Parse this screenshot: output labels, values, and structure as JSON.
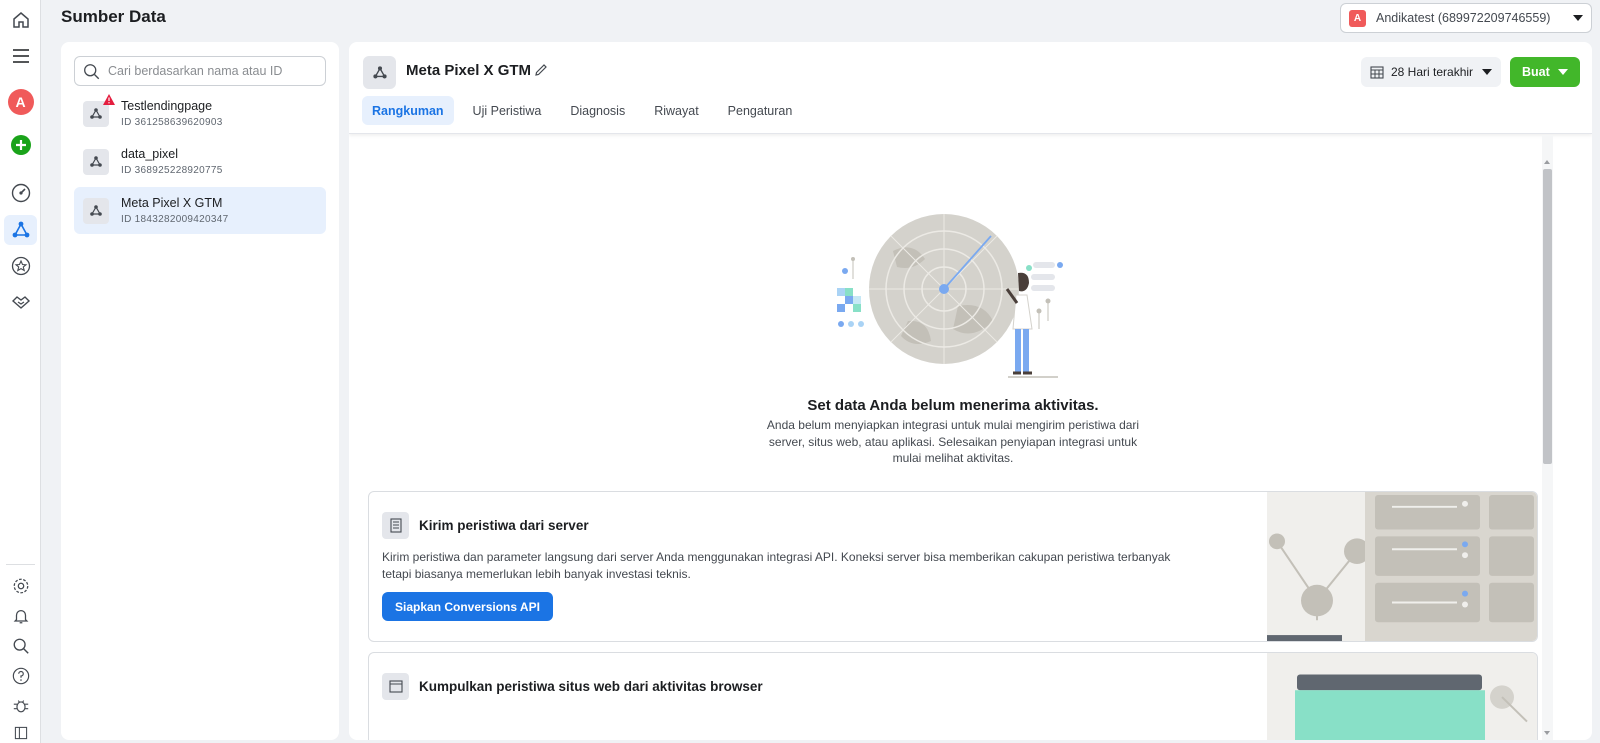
{
  "page": {
    "title": "Sumber Data"
  },
  "account": {
    "badge": "A",
    "name": "Andikatest (689972209746559)"
  },
  "rail": {
    "avatar_letter": "A",
    "top_icons": [
      "home-icon",
      "menu-icon",
      "avatar",
      "create-icon",
      "dashboard-icon",
      "data-sources-icon",
      "star-icon",
      "handshake-icon"
    ],
    "bottom_icons": [
      "settings-icon",
      "notifications-icon",
      "search-icon",
      "help-icon",
      "bug-icon",
      "sidebar-toggle-icon"
    ]
  },
  "sources": {
    "search_placeholder": "Cari berdasarkan nama atau ID",
    "items": [
      {
        "name": "Testlendingpage",
        "id": "ID 361258639620903",
        "warning": true
      },
      {
        "name": "data_pixel",
        "id": "ID 368925228920775",
        "warning": false
      },
      {
        "name": "Meta Pixel X GTM",
        "id": "ID 1843282009420347",
        "warning": false,
        "selected": true
      }
    ]
  },
  "main": {
    "title": "Meta Pixel X GTM",
    "tabs": [
      "Rangkuman",
      "Uji Peristiwa",
      "Diagnosis",
      "Riwayat",
      "Pengaturan"
    ],
    "active_tab": "Rangkuman",
    "date_range": "28 Hari terakhir",
    "create_label": "Buat",
    "empty": {
      "title": "Set data Anda belum menerima aktivitas.",
      "description": "Anda belum menyiapkan integrasi untuk mulai mengirim peristiwa dari server, situs web, atau aplikasi. Selesaikan penyiapan integrasi untuk mulai melihat aktivitas."
    },
    "cards": [
      {
        "title": "Kirim peristiwa dari server",
        "description": "Kirim peristiwa dan parameter langsung dari server Anda menggunakan integrasi API. Koneksi server bisa memberikan cakupan peristiwa terbanyak tetapi biasanya memerlukan lebih banyak investasi teknis.",
        "button": "Siapkan Conversions API",
        "icon": "server-icon"
      },
      {
        "title": "Kumpulkan peristiwa situs web dari aktivitas browser",
        "icon": "browser-icon"
      }
    ]
  },
  "colors": {
    "accent": "#1b74e4",
    "create": "#42b72a",
    "warning": "#e41e3f",
    "avatar": "#f05a5a"
  }
}
